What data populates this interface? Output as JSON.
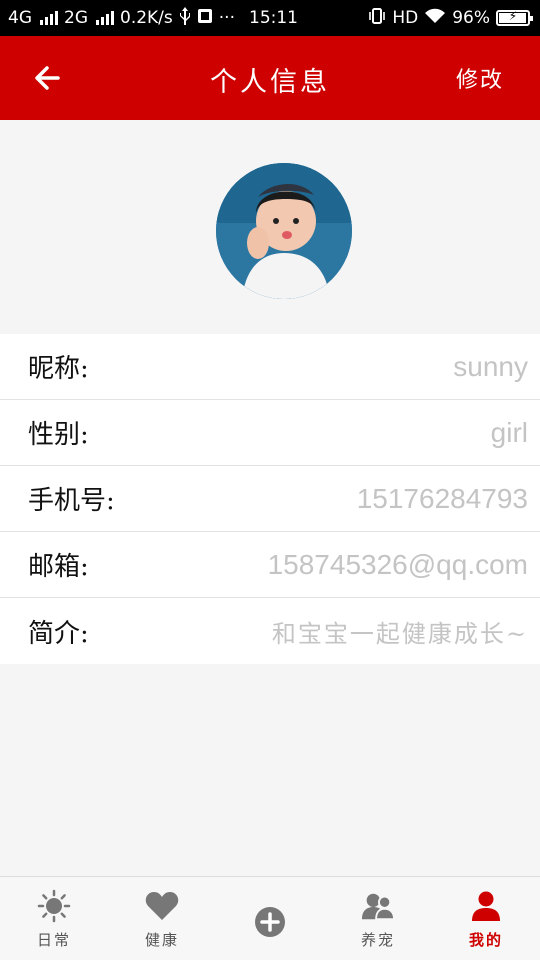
{
  "status_bar": {
    "net1": "4G",
    "net2": "2G",
    "speed": "0.2K/s",
    "more": "···",
    "time": "15:11",
    "hd": "HD",
    "battery": "96%"
  },
  "header": {
    "title": "个人信息",
    "edit_label": "修改",
    "accent_color": "#cf0000"
  },
  "profile": {
    "avatar_icon": "user-photo"
  },
  "fields": [
    {
      "label": "昵称:",
      "value": "sunny"
    },
    {
      "label": "性别:",
      "value": "girl"
    },
    {
      "label": "手机号:",
      "value": "15176284793"
    },
    {
      "label": "邮箱:",
      "value": "158745326@qq.com"
    },
    {
      "label": "简介:",
      "value": "和宝宝一起健康成长~"
    }
  ],
  "nav": {
    "items": [
      {
        "label": "日常",
        "icon": "sun-icon"
      },
      {
        "label": "健康",
        "icon": "heart-icon"
      },
      {
        "label": "",
        "icon": "plus-circle-icon"
      },
      {
        "label": "养宠",
        "icon": "people-icon"
      },
      {
        "label": "我的",
        "icon": "user-icon",
        "active": true
      }
    ]
  }
}
